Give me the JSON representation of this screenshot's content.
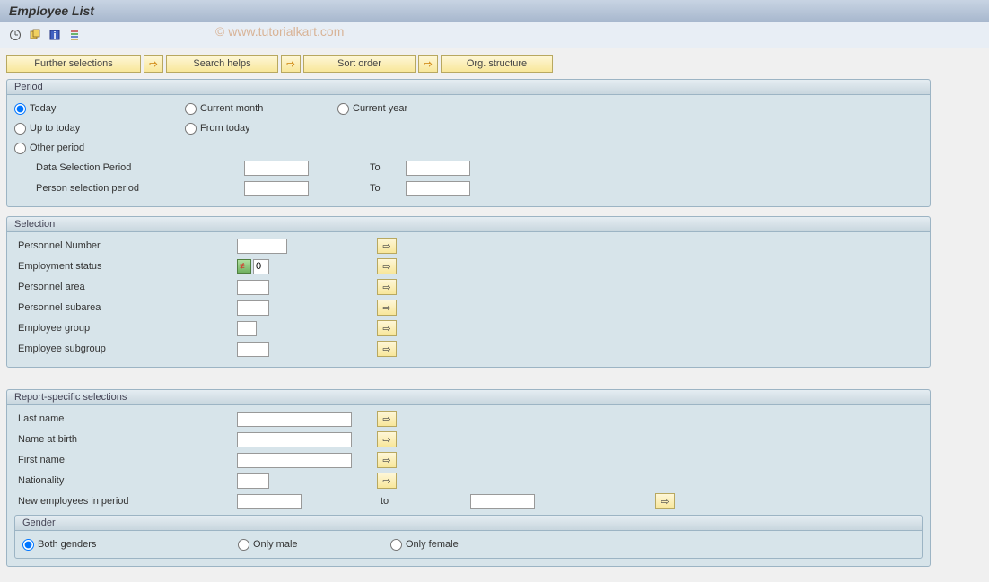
{
  "title": "Employee List",
  "watermark": "© www.tutorialkart.com",
  "topButtons": {
    "furtherSelections": "Further selections",
    "searchHelps": "Search helps",
    "sortOrder": "Sort order",
    "orgStructure": "Org. structure"
  },
  "period": {
    "title": "Period",
    "today": "Today",
    "currentMonth": "Current month",
    "currentYear": "Current year",
    "upToToday": "Up to today",
    "fromToday": "From today",
    "otherPeriod": "Other period",
    "dataSelectionPeriod": "Data Selection Period",
    "personSelectionPeriod": "Person selection period",
    "to": "To",
    "dataFrom": "",
    "dataTo": "",
    "personFrom": "",
    "personTo": ""
  },
  "selection": {
    "title": "Selection",
    "personnelNumber": "Personnel Number",
    "personnelNumberVal": "",
    "employmentStatus": "Employment status",
    "employmentStatusVal": "0",
    "personnelArea": "Personnel area",
    "personnelAreaVal": "",
    "personnelSubarea": "Personnel subarea",
    "personnelSubareaVal": "",
    "employeeGroup": "Employee group",
    "employeeGroupVal": "",
    "employeeSubgroup": "Employee subgroup",
    "employeeSubgroupVal": ""
  },
  "report": {
    "title": "Report-specific selections",
    "lastName": "Last name",
    "lastNameVal": "",
    "nameAtBirth": "Name at birth",
    "nameAtBirthVal": "",
    "firstName": "First name",
    "firstNameVal": "",
    "nationality": "Nationality",
    "nationalityVal": "",
    "newEmployees": "New employees in period",
    "newEmployeesFrom": "",
    "newEmployeesTo": "",
    "to": "to",
    "gender": {
      "title": "Gender",
      "both": "Both genders",
      "male": "Only male",
      "female": "Only female"
    }
  },
  "indicator": "≢"
}
